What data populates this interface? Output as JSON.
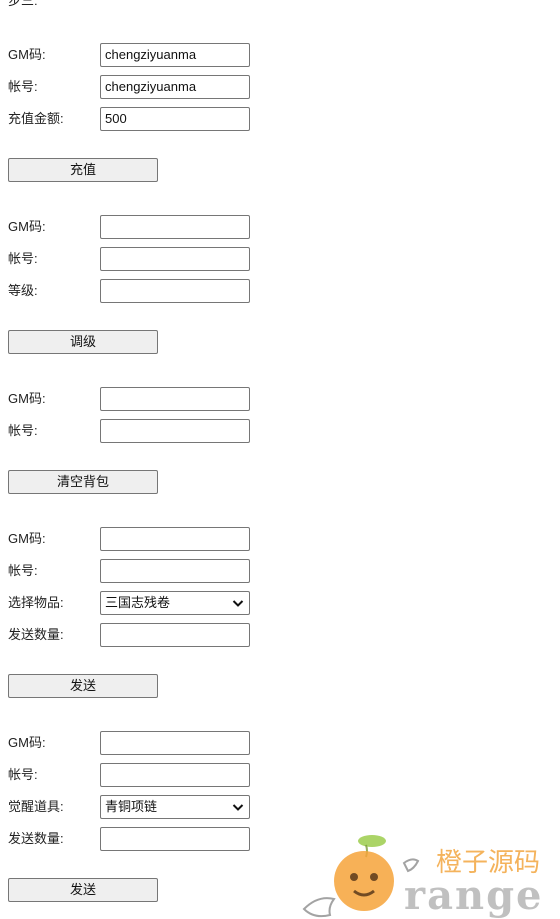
{
  "header": {
    "text": "步三:"
  },
  "recharge": {
    "gm_label": "GM码:",
    "gm_value": "chengziyuanma",
    "account_label": "帐号:",
    "account_value": "chengziyuanma",
    "amount_label": "充值金额:",
    "amount_value": "500",
    "button_label": "充值"
  },
  "level": {
    "gm_label": "GM码:",
    "gm_value": "",
    "account_label": "帐号:",
    "account_value": "",
    "level_label": "等级:",
    "level_value": "",
    "button_label": "调级"
  },
  "clear_bag": {
    "gm_label": "GM码:",
    "gm_value": "",
    "account_label": "帐号:",
    "account_value": "",
    "button_label": "清空背包"
  },
  "send_item": {
    "gm_label": "GM码:",
    "gm_value": "",
    "account_label": "帐号:",
    "account_value": "",
    "item_label": "选择物品:",
    "item_selected": "三国志残卷",
    "qty_label": "发送数量:",
    "qty_value": "",
    "button_label": "发送"
  },
  "send_awaken": {
    "gm_label": "GM码:",
    "gm_value": "",
    "account_label": "帐号:",
    "account_value": "",
    "item_label": "觉醒道具:",
    "item_selected": "青铜项链",
    "qty_label": "发送数量:",
    "qty_value": "",
    "button_label": "发送"
  },
  "watermark": {
    "cn_text": "橙子源码",
    "en_text": "range",
    "colors": {
      "orange": "#f3a640",
      "gray": "#8e8e8e"
    }
  }
}
